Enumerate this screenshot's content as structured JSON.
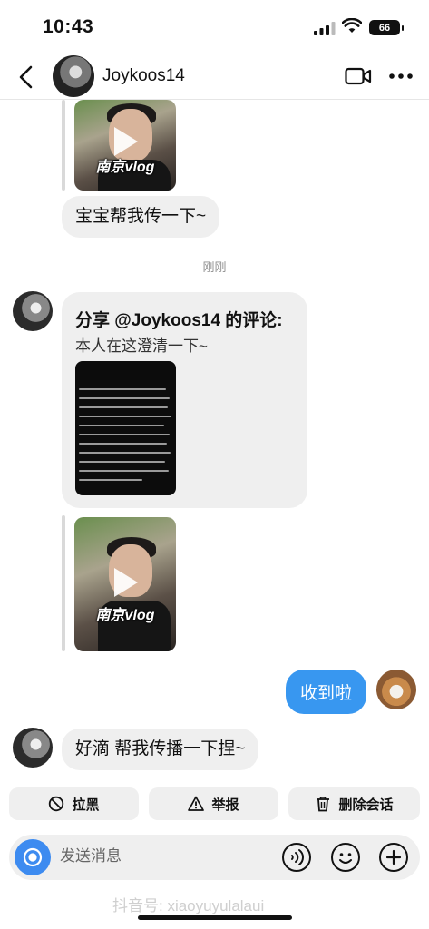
{
  "status_bar": {
    "time": "10:43",
    "battery": "66"
  },
  "header": {
    "username": "Joykoos14"
  },
  "video_1": {
    "tag": "南京vlog"
  },
  "messages": {
    "msg1": "宝宝帮我传一下~",
    "timestamp": "刚刚",
    "share_title": "分享 @Joykoos14 的评论:",
    "share_subtitle": "本人在这澄清一下~",
    "video_2_tag": "南京vlog",
    "sent_reply": "收到啦",
    "msg_last": "好滴 帮我传播一下捏~"
  },
  "actions": {
    "block": "拉黑",
    "report": "举报",
    "delete": "删除会话"
  },
  "composer": {
    "placeholder": "发送消息"
  },
  "watermark": "抖音号: xiaoyuyulalaui",
  "colors": {
    "accent": "#3897f0",
    "bubble": "#efefef",
    "camera": "#3d8bf0"
  }
}
